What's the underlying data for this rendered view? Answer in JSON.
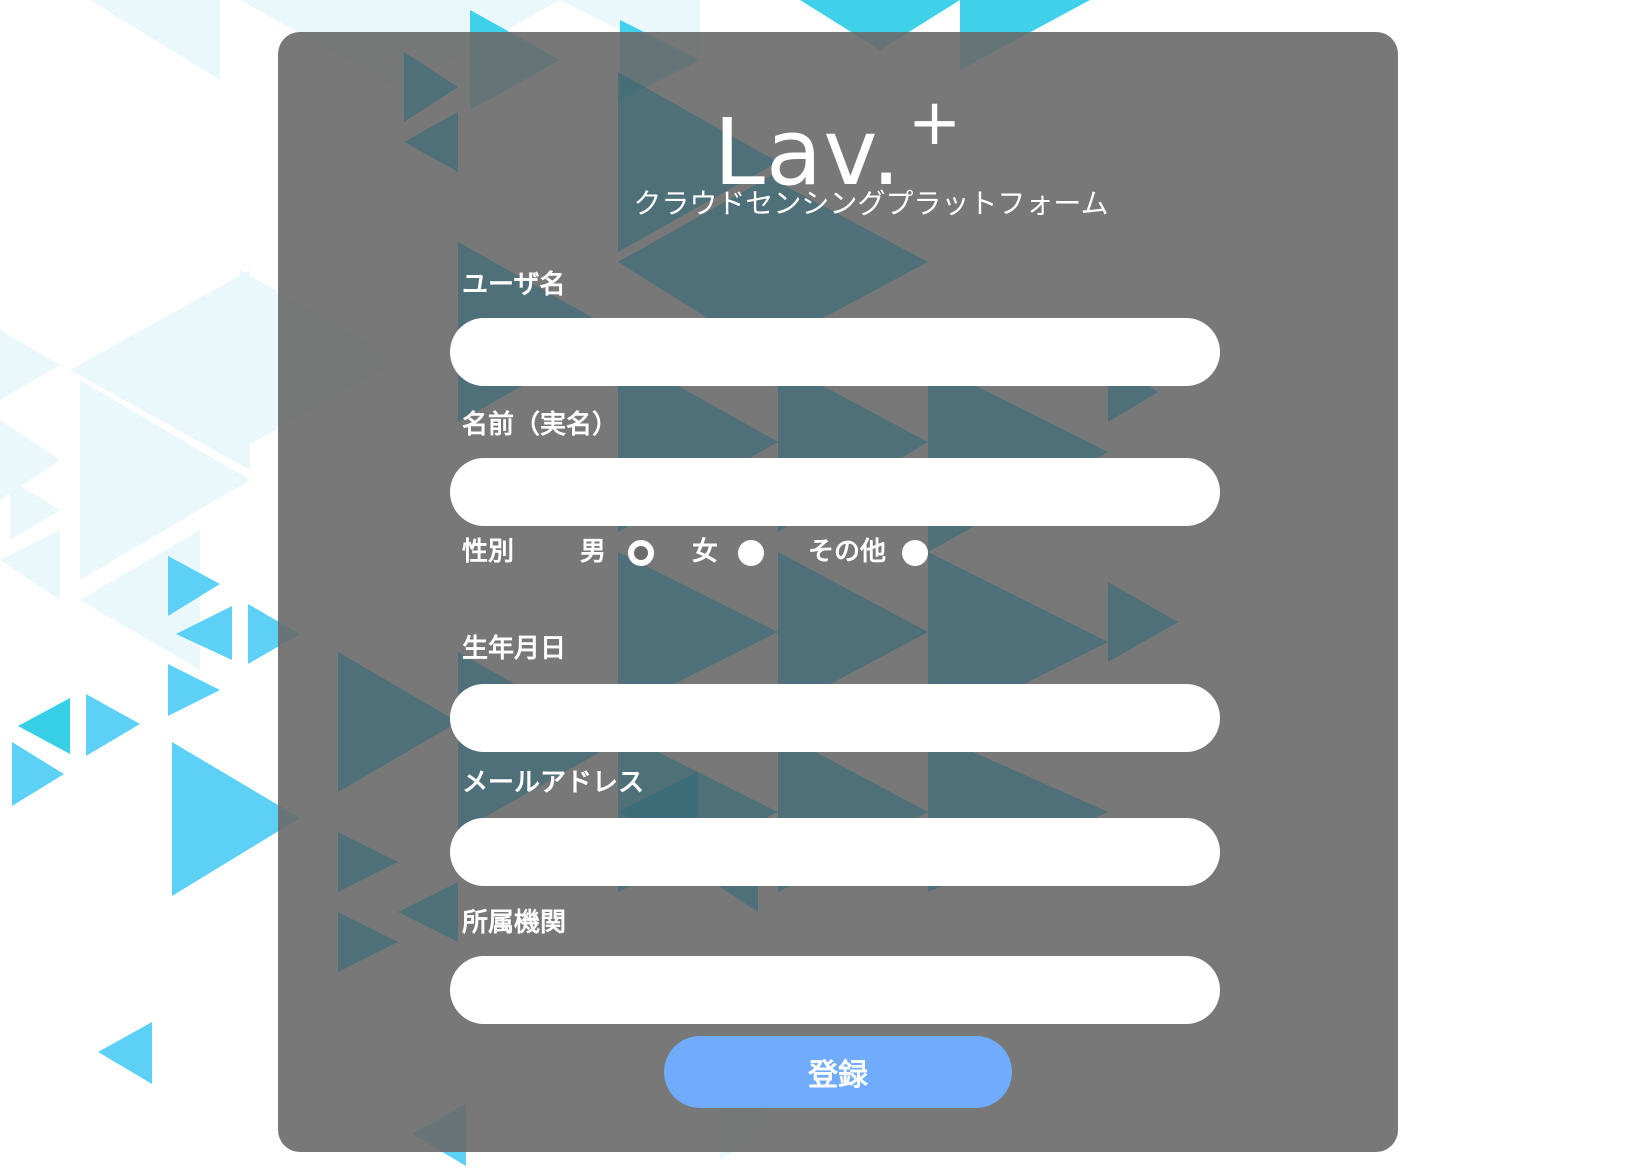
{
  "brand": {
    "logo_text": "Lav.",
    "logo_plus": "+",
    "subtitle": "クラウドセンシングプラットフォーム"
  },
  "form": {
    "username": {
      "label": "ユーザ名",
      "value": "",
      "placeholder": ""
    },
    "real_name": {
      "label": "名前（実名）",
      "value": "",
      "placeholder": ""
    },
    "gender": {
      "label": "性別",
      "options": [
        {
          "label": "男",
          "checked": true
        },
        {
          "label": "女",
          "checked": false
        },
        {
          "label": "その他",
          "checked": false
        }
      ]
    },
    "birthdate": {
      "label": "生年月日",
      "value": "",
      "placeholder": ""
    },
    "email": {
      "label": "メールアドレス",
      "value": "",
      "placeholder": ""
    },
    "affiliation": {
      "label": "所属機関",
      "value": "",
      "placeholder": ""
    },
    "submit_label": "登録"
  },
  "colors": {
    "panel": "#696969",
    "button": "#70acfb",
    "triangle_light": "#e8f6fb",
    "triangle_mid": "#5cc8ee",
    "triangle_strong": "#3fc3e6"
  }
}
